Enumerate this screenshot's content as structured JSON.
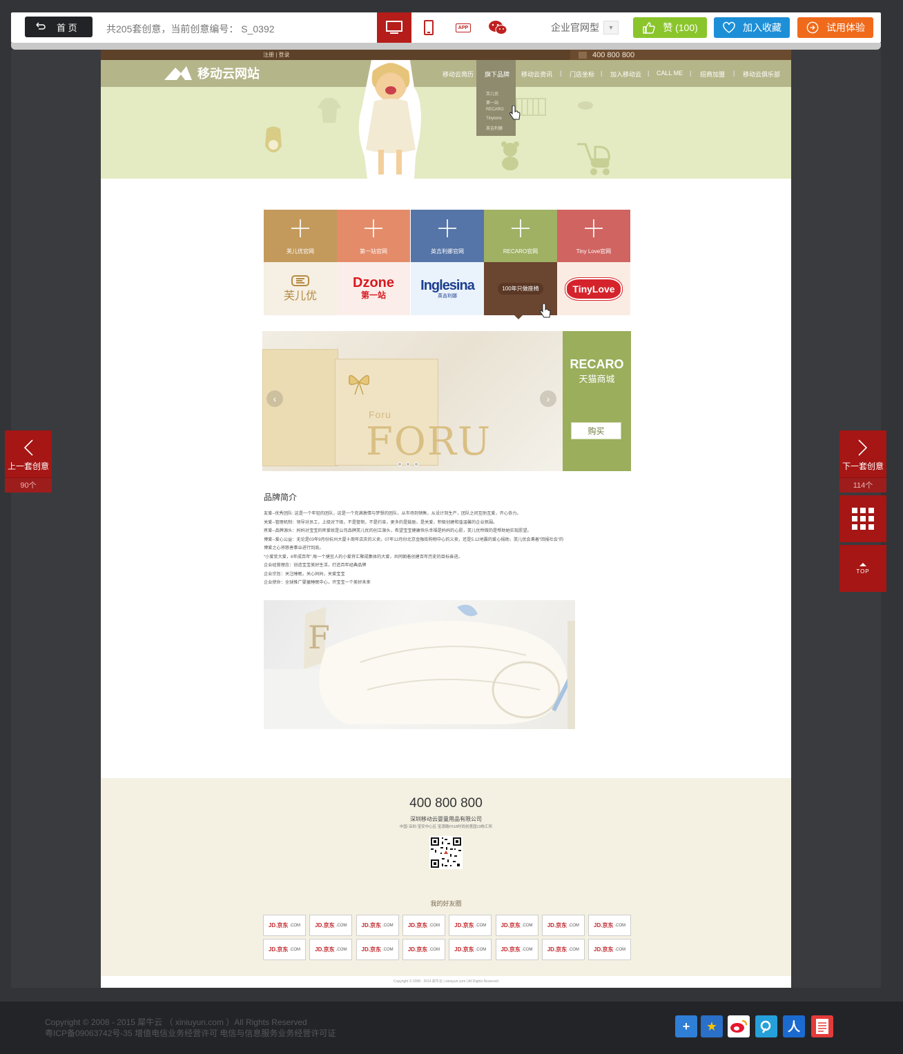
{
  "toolbar": {
    "home_label": "首 页",
    "count_text": "共205套创意，当前创意编号： S_0392",
    "device_tabs": [
      "desktop",
      "tablet",
      "app",
      "wechat"
    ],
    "app_badge": "APP",
    "type_label": "企业官网型",
    "like_label": "赞 (100)",
    "fav_label": "加入收藏",
    "trial_label": "试用体验"
  },
  "site": {
    "top": {
      "reg_login": "注册 | 登录",
      "phone": "400 800 800"
    },
    "logo": "移动云网站",
    "nav": [
      "移动云简历",
      "旗下品牌",
      "移动云资讯",
      "门店坐标",
      "加入移动云",
      "CALL ME",
      "招商加盟",
      "移动云俱乐部"
    ],
    "dropdown": [
      "芙儿优",
      "第一站",
      "RECARO",
      "Tinytone",
      "英吉利娜"
    ],
    "tiles": [
      {
        "label": "芙儿优官网",
        "color": "#c39a5c"
      },
      {
        "label": "第一站官网",
        "color": "#e48c6a"
      },
      {
        "label": "英吉利娜官网",
        "color": "#5574a7"
      },
      {
        "label": "RECARO官网",
        "color": "#a0b164"
      },
      {
        "label": "Tiny Love官网",
        "color": "#d06461"
      }
    ],
    "brands": {
      "foru": "芙儿优",
      "dzone": "Dzone",
      "dzone_cn": "第一站",
      "inglesina": "Inglesina",
      "inglesina_cn": "英吉利娜",
      "recaro_hover": "100年只做座椅",
      "tinylove": "TinyLove"
    },
    "slider": {
      "box_brand": "FORU",
      "logo_text": "Foru",
      "big_text": "FORU"
    },
    "promo": {
      "title": "RECARO",
      "subtitle": "天猫商城",
      "buy": "购买"
    },
    "intro_title": "品牌简介",
    "intro_lines": [
      "友爱--优秀团队: 这是一个年轻的团队，这是一个充满激情与梦想的团队，从市场到销售，从设计到生产，团队之间互助互爱，齐心协力。",
      "关爱--管理机制：领导对员工，上级对下级，不是管制，不是约束，更多的是鼓励，是关爱，积极创建和谐温馨的企业氛围。",
      "疼爱--品牌源头：妈妈对宝宝的疼爱就是公司品牌芙儿优的创立源头，希望宝宝健康快乐幸福是妈妈的心愿，芙儿优所做的是帮助她实现愿望。",
      "博爱--爱心公益：无论是03年9月份杭州大厦十周年店庆的义卖，07年12月份北京金融街购物中心的义卖，还是5.12地震的爱心捐助，芙儿优会秉着“回报社会”的",
      "博爱之心将慈善事业进行到底。",
      "“小爱变大爱，6年成百年”,每一个捷宜人的小爱将汇聚成集体的大爱，共同朝着创建百年历史的目标奋进。",
      "企业经营理念：创造宝宝美好生活，打造百年经典品牌",
      "企业宗旨：关注睡眠，关心妈妈，关爱宝宝",
      "企业使命：全球推广婴童睡眠中心，许宝宝一个美好未来"
    ],
    "footer": {
      "phone": "400 800 800",
      "company": "深圳移动云婴童用品有限公司",
      "address": "中国·深圳·宝安中心区·宝源路F518时尚创意园13栋汇所",
      "friends_title": "我的好友圈",
      "friend_logo": "JD.京东",
      "friend_logo_sub": ".COM",
      "friend_count": 16,
      "copyright": "Copyright © 2008 - 2014 犀牛云 | xiniuyun.com | All Rights Reserved"
    }
  },
  "side": {
    "prev_label": "上一套创意",
    "prev_count": "90个",
    "next_label": "下一套创意",
    "next_count": "114个",
    "top_label": "TOP"
  },
  "bottom": {
    "copyright": "Copyright © 2008 - 2015 犀牛云 （ xiniuyun.com ）All Rights Reserved",
    "icp": "粤ICP备09063742号-35 增值电信业务经营许可 电信与信息服务业务经营许可证",
    "share_icons": [
      "add-share-icon",
      "qzone-icon",
      "weibo-icon",
      "tencent-weibo-icon",
      "renren-icon",
      "more-share-icon"
    ]
  }
}
